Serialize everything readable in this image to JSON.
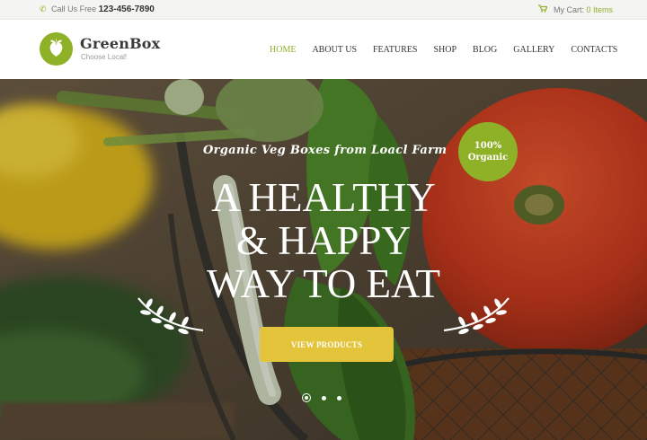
{
  "topbar": {
    "phone_prefix": "Call Us Free",
    "phone_number": "123-456-7890",
    "phone_icon": "phone-icon",
    "cart_label": "My Cart:",
    "cart_items": "0 Items",
    "cart_icon": "cart-icon"
  },
  "logo": {
    "name": "GreenBox",
    "tagline": "Choose Local!"
  },
  "nav": {
    "items": [
      {
        "label": "HOME",
        "active": true
      },
      {
        "label": "ABOUT US"
      },
      {
        "label": "FEATURES"
      },
      {
        "label": "SHOP"
      },
      {
        "label": "BLOG"
      },
      {
        "label": "GALLERY"
      },
      {
        "label": "CONTACTS"
      }
    ]
  },
  "hero": {
    "subtitle": "Organic Veg Boxes from Loacl Farm",
    "badge_line1": "100%",
    "badge_line2": "Organic",
    "headline_line1": "A HEALTHY",
    "headline_line2": "& HAPPY",
    "headline_line3": "WAY TO EAT",
    "cta_label": "VIEW PRODUCTS",
    "slides_total": 3,
    "active_slide": 1
  },
  "colors": {
    "accent_green": "#8fb128",
    "cta_yellow": "#e4c43a"
  }
}
